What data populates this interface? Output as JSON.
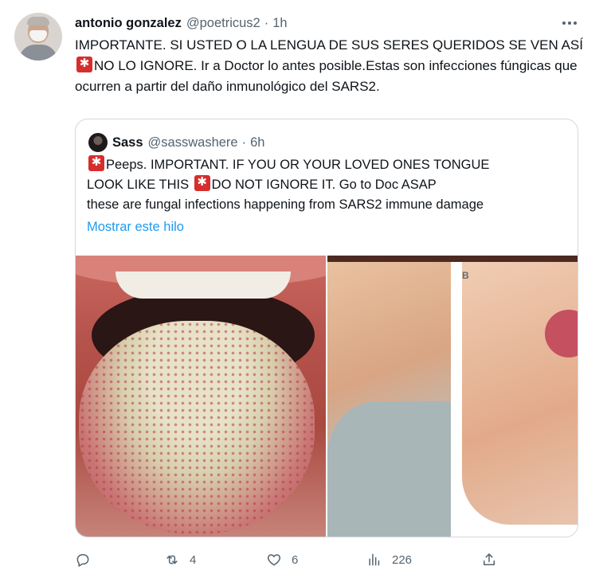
{
  "tweet": {
    "author_name": "antonio gonzalez",
    "author_handle": "@poetricus2",
    "separator": "·",
    "time": "1h",
    "text_part1": "IMPORTANTE. SI USTED O LA LENGUA DE SUS SERES QUERIDOS SE VEN ASÍ ",
    "text_part2": "NO LO IGNORE. Ir a Doctor lo antes posible.Estas son infecciones fúngicas que ocurren a partir del daño inmunológico del SARS2."
  },
  "quote": {
    "author_name": "Sass",
    "author_handle": "@sasswashere",
    "separator": "·",
    "time": "6h",
    "line1": "Peeps. IMPORTANT. IF YOU OR YOUR LOVED ONES TONGUE",
    "line2a": "LOOK LIKE THIS ",
    "line2b": "DO NOT IGNORE IT. Go to Doc ASAP",
    "line3": "these are fungal infections happening from SARS2 immune damage",
    "show_thread": "Mostrar este hilo",
    "image_right_label": "B"
  },
  "actions": {
    "retweets": "4",
    "likes": "6",
    "views": "226"
  },
  "icons": {
    "reply": "reply-icon",
    "retweet": "retweet-icon",
    "like": "heart-icon",
    "views": "views-icon",
    "share": "share-icon",
    "emoji": "police-light-emoji"
  },
  "colors": {
    "text": "#0f1419",
    "secondary": "#536471",
    "link": "#1d9bf0",
    "border": "#cfd9de"
  }
}
